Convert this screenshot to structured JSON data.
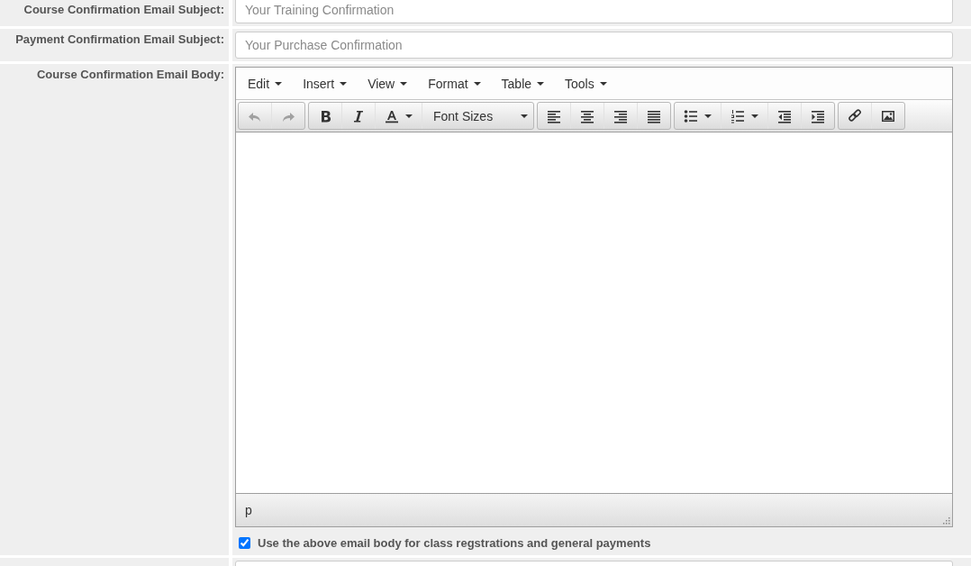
{
  "fields": [
    {
      "label": "Course Confirmation Email Subject:",
      "placeholder": "Your Training Confirmation"
    },
    {
      "label": "Payment Confirmation Email Subject:",
      "placeholder": "Your Purchase Confirmation"
    }
  ],
  "editor": {
    "label": "Course Confirmation Email Body:",
    "menus": [
      "Edit",
      "Insert",
      "View",
      "Format",
      "Table",
      "Tools"
    ],
    "toolbar": [
      [
        {
          "kind": "icon",
          "disabled": true
        },
        {
          "kind": "icon",
          "disabled": true
        }
      ],
      [
        {
          "kind": "icon",
          "disabled": false
        },
        {
          "kind": "icon",
          "disabled": false
        },
        {
          "kind": "split",
          "disabled": false
        },
        {
          "kind": "select",
          "label": "Font Sizes",
          "disabled": false
        }
      ],
      [
        {
          "kind": "icon",
          "disabled": false
        },
        {
          "kind": "icon",
          "disabled": false
        },
        {
          "kind": "icon",
          "disabled": false
        },
        {
          "kind": "icon",
          "disabled": false
        }
      ],
      [
        {
          "kind": "split",
          "disabled": false
        },
        {
          "kind": "split",
          "disabled": false
        },
        {
          "kind": "icon",
          "disabled": false
        },
        {
          "kind": "icon",
          "disabled": false
        }
      ],
      [
        {
          "kind": "icon",
          "disabled": false
        },
        {
          "kind": "icon",
          "disabled": false
        }
      ]
    ],
    "path": "p"
  },
  "option": {
    "label": "Use the above email body for class regstrations and general payments",
    "checked": true
  }
}
